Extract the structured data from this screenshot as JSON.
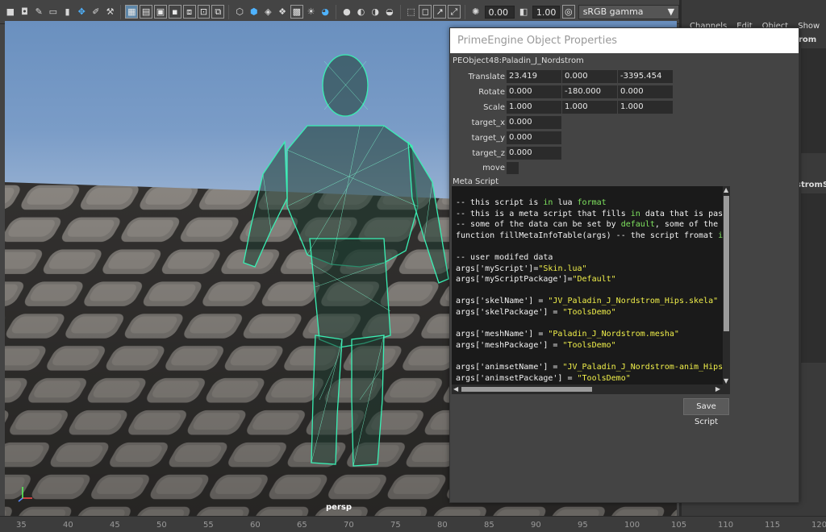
{
  "toolbar": {
    "exposure_value": "0.00",
    "gamma_value": "1.00",
    "color_space": "sRGB gamma"
  },
  "viewport": {
    "camera_label": "persp",
    "axis_labels": [
      "x",
      "y",
      "z"
    ]
  },
  "right_panel": {
    "menu": [
      "Channels",
      "Edit",
      "Object",
      "Show"
    ],
    "cut_text_1": "rom",
    "cut_text_2": "stromS"
  },
  "dialog": {
    "title": "PrimeEngine Object Properties",
    "object_name": "PEObject48:Paladin_J_Nordstrom",
    "translate": {
      "label": "Translate",
      "x": "23.419",
      "y": "0.000",
      "z": "-3395.454"
    },
    "rotate": {
      "label": "Rotate",
      "x": "0.000",
      "y": "-180.000",
      "z": "0.000"
    },
    "scale": {
      "label": "Scale",
      "x": "1.000",
      "y": "1.000",
      "z": "1.000"
    },
    "target_x": {
      "label": "target_x",
      "value": "0.000"
    },
    "target_y": {
      "label": "target_y",
      "value": "0.000"
    },
    "target_z": {
      "label": "target_z",
      "value": "0.000"
    },
    "move_label": "move",
    "meta_script_label": "Meta Script",
    "script_lines": [
      [
        [
          "-- this script is ",
          "c"
        ],
        [
          "in",
          "kw"
        ],
        [
          " lua ",
          "c"
        ],
        [
          "format",
          "kw"
        ]
      ],
      [
        [
          "-- this is a meta script that fills ",
          "c"
        ],
        [
          "in",
          "kw"
        ],
        [
          " data that is pas",
          "c"
        ]
      ],
      [
        [
          "-- some of the data can be set by ",
          "c"
        ],
        [
          "default",
          "kw"
        ],
        [
          ", some of the",
          "c"
        ]
      ],
      [
        [
          "function fillMetaInfoTable(args) -- the script fromat ",
          "c"
        ],
        [
          "i",
          "kw"
        ]
      ],
      [
        [
          "",
          "c"
        ]
      ],
      [
        [
          "-- user modifed data",
          "c"
        ]
      ],
      [
        [
          "args['myScript']=",
          "c"
        ],
        [
          "\"Skin.lua\"",
          "str"
        ]
      ],
      [
        [
          "args['myScriptPackage']=",
          "c"
        ],
        [
          "\"Default\"",
          "str"
        ]
      ],
      [
        [
          "",
          "c"
        ]
      ],
      [
        [
          "args['skelName'] = ",
          "c"
        ],
        [
          "\"JV_Paladin_J_Nordstrom_Hips.skela\"",
          "str"
        ]
      ],
      [
        [
          "args['skelPackage'] = ",
          "c"
        ],
        [
          "\"ToolsDemo\"",
          "str"
        ]
      ],
      [
        [
          "",
          "c"
        ]
      ],
      [
        [
          "args['meshName'] = ",
          "c"
        ],
        [
          "\"Paladin_J_Nordstrom.mesha\"",
          "str"
        ]
      ],
      [
        [
          "args['meshPackage'] = ",
          "c"
        ],
        [
          "\"ToolsDemo\"",
          "str"
        ]
      ],
      [
        [
          "",
          "c"
        ]
      ],
      [
        [
          "args['animsetName'] = ",
          "c"
        ],
        [
          "\"JV_Paladin_J_Nordstrom-anim_Hips",
          "str"
        ]
      ],
      [
        [
          "args['animsetPackage'] = ",
          "c"
        ],
        [
          "\"ToolsDemo\"",
          "str"
        ]
      ]
    ],
    "save_button": "Save Script"
  },
  "ruler": {
    "ticks": [
      "35",
      "40",
      "45",
      "50",
      "55",
      "60",
      "65",
      "70",
      "75",
      "80",
      "85",
      "90",
      "95",
      "100",
      "105",
      "110",
      "115",
      "120"
    ]
  },
  "colors": {
    "wireframe": "#39f0b4",
    "sky": "#7a9cc7",
    "keyword": "#7fe45f",
    "string": "#f0ef4a"
  }
}
